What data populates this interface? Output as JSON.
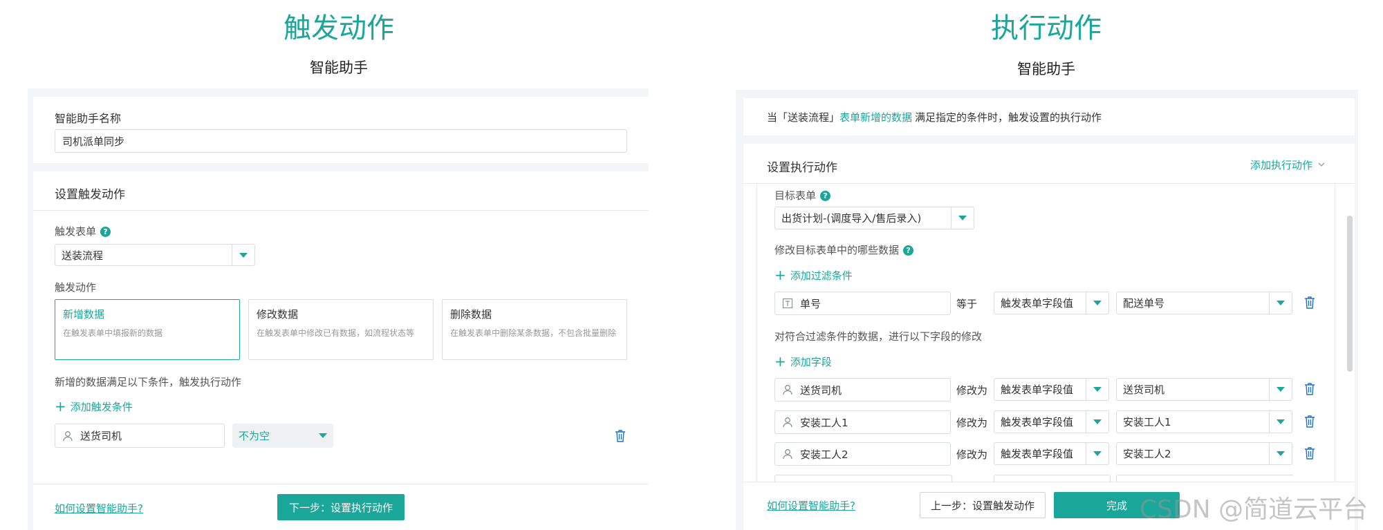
{
  "left": {
    "title": "触发动作",
    "subtitle": "智能助手",
    "name_label": "智能助手名称",
    "name_value": "司机派单同步",
    "section_title": "设置触发动作",
    "form_label": "触发表单",
    "form_value": "送装流程",
    "action_label": "触发动作",
    "actions": [
      {
        "title": "新增数据",
        "desc": "在触发表单中填报新的数据"
      },
      {
        "title": "修改数据",
        "desc": "在触发表单中修改已有数据，如流程状态等"
      },
      {
        "title": "删除数据",
        "desc": "在触发表单中删除某条数据，不包含批量删除"
      }
    ],
    "condition_text": "新增的数据满足以下条件，触发执行动作",
    "add_condition": "添加触发条件",
    "cond_field": "送货司机",
    "cond_op": "不为空",
    "help_link": "如何设置智能助手?",
    "next_button": "下一步：设置执行动作"
  },
  "right": {
    "title": "执行动作",
    "subtitle": "智能助手",
    "banner_prefix": "当「送装流程」",
    "banner_link": "表单新增的数据",
    "banner_suffix": "满足指定的条件时，触发设置的执行动作",
    "section_title": "设置执行动作",
    "add_action": "添加执行动作",
    "target_label": "目标表单",
    "target_value": "出货计划-(调度导入/售后录入)",
    "modify_label": "修改目标表单中的哪些数据",
    "add_filter": "添加过滤条件",
    "filter_row": {
      "field": "单号",
      "op": "等于",
      "source": "触发表单字段值",
      "value": "配送单号"
    },
    "fields_label": "对符合过滤条件的数据，进行以下字段的修改",
    "add_field": "添加字段",
    "field_rows": [
      {
        "field": "送货司机",
        "op": "修改为",
        "source": "触发表单字段值",
        "value": "送货司机"
      },
      {
        "field": "安装工人1",
        "op": "修改为",
        "source": "触发表单字段值",
        "value": "安装工人1"
      },
      {
        "field": "安装工人2",
        "op": "修改为",
        "source": "触发表单字段值",
        "value": "安装工人2"
      }
    ],
    "help_link": "如何设置智能助手?",
    "prev_button": "上一步：设置触发动作",
    "done_button": "完成"
  },
  "watermark": "CSDN @简道云平台",
  "colors": {
    "accent": "#1aa79a",
    "panel_bg": "#f4f5f6"
  }
}
